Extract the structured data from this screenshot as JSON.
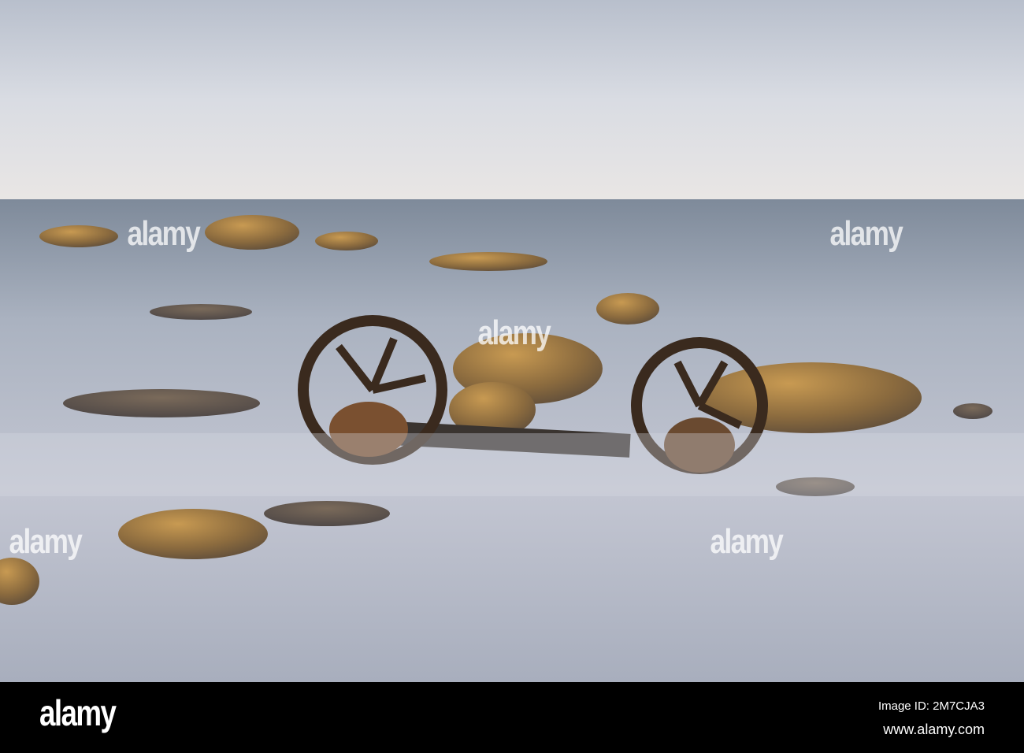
{
  "photo": {
    "subject": "wagon-wheels-in-misty-sea"
  },
  "watermark": {
    "text": "alamy"
  },
  "footer": {
    "logo": "alamy",
    "image_id": "Image ID: 2M7CJA3",
    "url": "www.alamy.com"
  }
}
